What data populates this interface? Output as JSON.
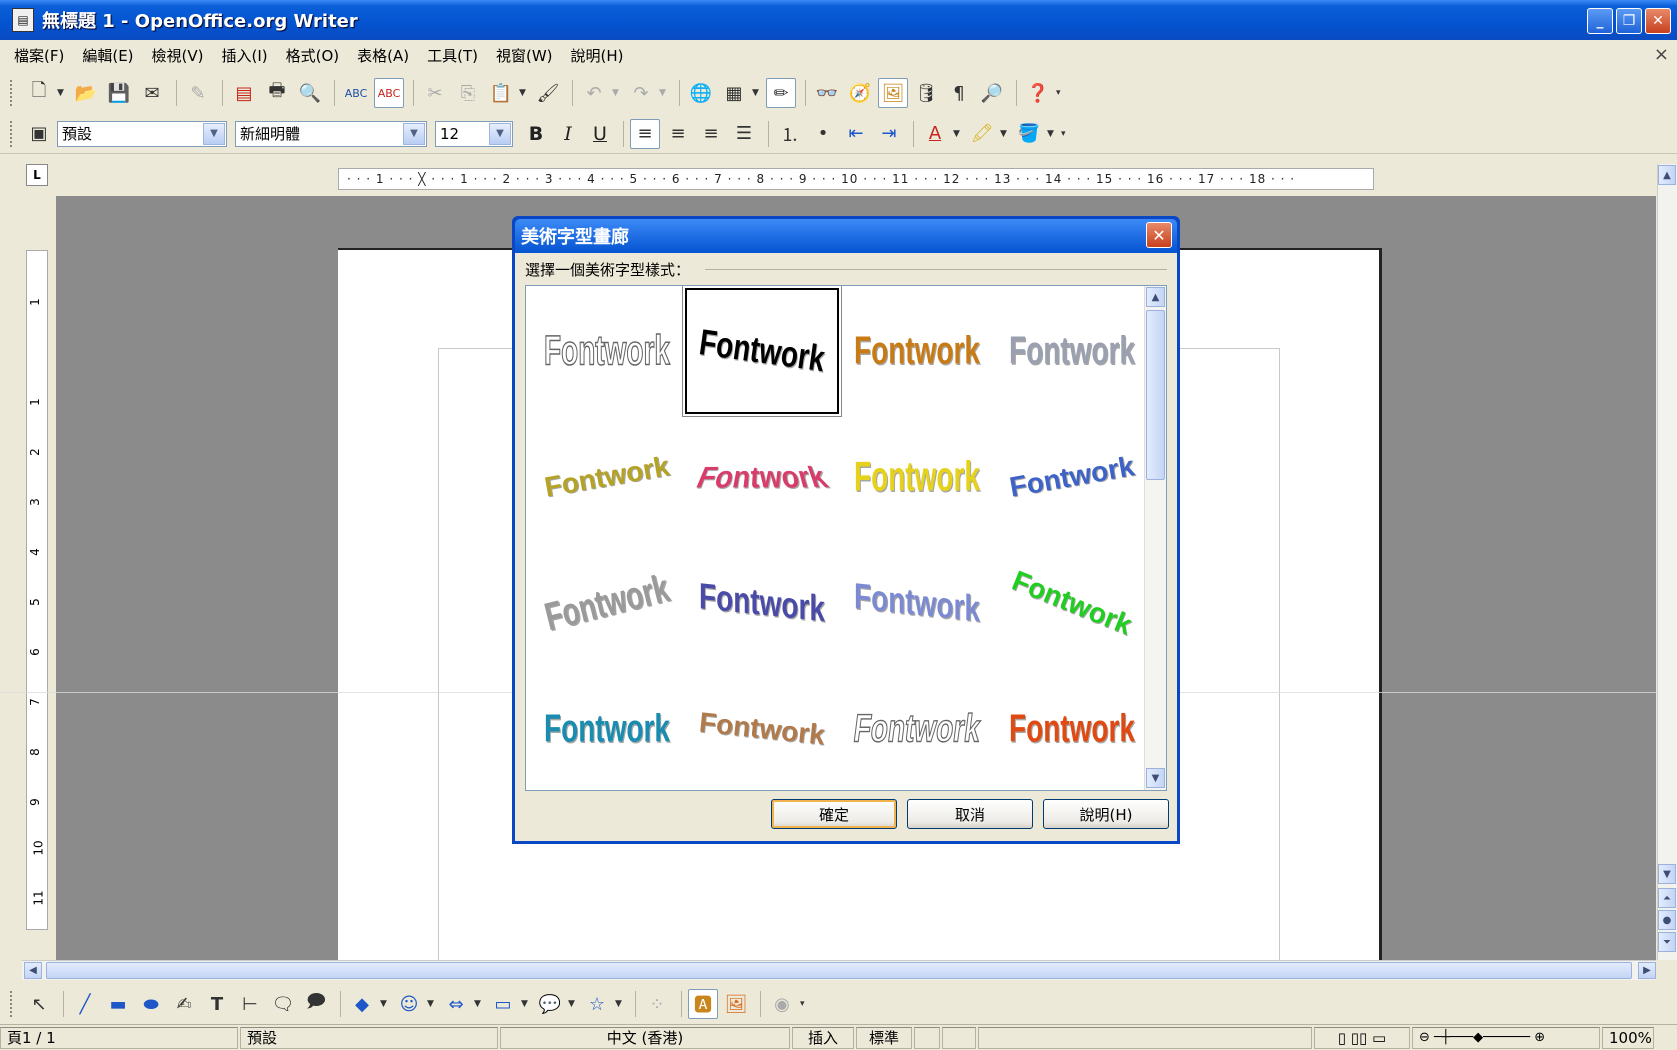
{
  "window": {
    "title": "無標題 1 - OpenOffice.org Writer",
    "buttons": [
      "minimize",
      "restore",
      "close"
    ]
  },
  "menubar": {
    "items": [
      "檔案(F)",
      "編輯(E)",
      "檢視(V)",
      "插入(I)",
      "格式(O)",
      "表格(A)",
      "工具(T)",
      "視窗(W)",
      "說明(H)"
    ],
    "close_glyph": "×"
  },
  "format_toolbar": {
    "paragraph_style": "預設",
    "font_name": "新細明體",
    "font_size": "12",
    "bold": "B",
    "italic": "I",
    "underline": "U"
  },
  "ruler": {
    "corner": "L",
    "horizontal_ticks": "· · · 1 · · · ╳ · · · 1 · · · 2 · · · 3 · · · 4 · · · 5 · · · 6 · · · 7 · · · 8 · · · 9 · · · 10 · · · 11 · · · 12 · · · 13 · · · 14 · · · 15 · · · 16 · · · 17 · · · 18 · · ·",
    "vertical_ticks": [
      "1",
      "1",
      "2",
      "3",
      "4",
      "5",
      "6",
      "7",
      "8",
      "9",
      "10",
      "11"
    ]
  },
  "dialog": {
    "title": "美術字型畫廊",
    "label": "選擇一個美術字型樣式：",
    "items": [
      {
        "text": "Fontwork",
        "color": "#ffffff",
        "style": "outline"
      },
      {
        "text": "Fontwork",
        "color": "#000000",
        "style": "arch"
      },
      {
        "text": "Fontwork",
        "color": "#c87b14",
        "style": "gold"
      },
      {
        "text": "Fontwork",
        "color": "#9aa0b0",
        "style": "gray"
      },
      {
        "text": "Fontwork",
        "color": "#b5a326",
        "style": "slant"
      },
      {
        "text": "Fontwork",
        "color": "#d83c6a",
        "style": "perspective"
      },
      {
        "text": "Fontwork",
        "color": "#e6d21a",
        "style": "yellow"
      },
      {
        "text": "Fontwork",
        "color": "#3d63c8",
        "style": "blue-wave"
      },
      {
        "text": "Fontwork",
        "color": "#9a9a9a",
        "style": "3d-gray"
      },
      {
        "text": "Fontwork",
        "color": "#4a4aa8",
        "style": "3d-purple"
      },
      {
        "text": "Fontwork",
        "color": "#7c8ad2",
        "style": "3d-lilac"
      },
      {
        "text": "Fontwork",
        "color": "#1fce1f",
        "style": "green-arc"
      },
      {
        "text": "Fontwork",
        "color": "#1a8cb0",
        "style": "teal"
      },
      {
        "text": "Fontwork",
        "color": "#b07a4a",
        "style": "brown-arc"
      },
      {
        "text": "Fontwork",
        "color": "#b0b0c8",
        "style": "outline-lilac"
      },
      {
        "text": "Fontwork",
        "color": "#e04a12",
        "style": "fire"
      }
    ],
    "selected_index": 1,
    "ok": "確定",
    "cancel": "取消",
    "help": "說明(H)"
  },
  "statusbar": {
    "page": "頁1 / 1",
    "style": "預設",
    "language": "中文 (香港)",
    "insert_mode": "插入",
    "selection_mode": "標準",
    "zoom": "100%"
  }
}
